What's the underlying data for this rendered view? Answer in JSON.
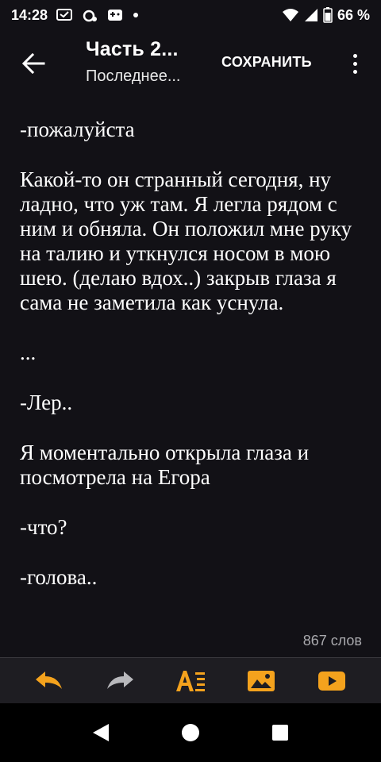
{
  "status_bar": {
    "time": "14:28",
    "battery_percent": "66 %",
    "icons_left": [
      "message-icon",
      "alarm-icon",
      "gamepad-icon",
      "dot-icon"
    ],
    "icons_right": [
      "wifi-icon",
      "cell-signal-icon",
      "battery-icon"
    ]
  },
  "app_bar": {
    "title": "Часть 2...",
    "subtitle": "Последнее...",
    "save_label": "СОХРАНИТЬ"
  },
  "editor": {
    "paragraphs": [
      "-пожалуйста",
      "Какой-то он странный сегодня, ну ладно, что уж там. Я легла рядом с ним и обняла. Он положил мне руку на талию и уткнулся носом в мою шею. (делаю вдох..) закрыв глаза я сама не заметила как уснула.",
      "...",
      "-Лер..",
      "Я моментально открыла глаза и посмотрела на Егора",
      "-что?",
      "-голова.."
    ]
  },
  "word_count": "867 слов",
  "toolbar": {
    "accent_color": "#f4a21d",
    "icons": [
      "undo-icon",
      "redo-icon",
      "text-format-icon",
      "insert-image-icon",
      "insert-video-icon"
    ]
  },
  "nav_bar": {
    "icons": [
      "back-triangle-icon",
      "home-circle-icon",
      "recents-square-icon"
    ]
  }
}
